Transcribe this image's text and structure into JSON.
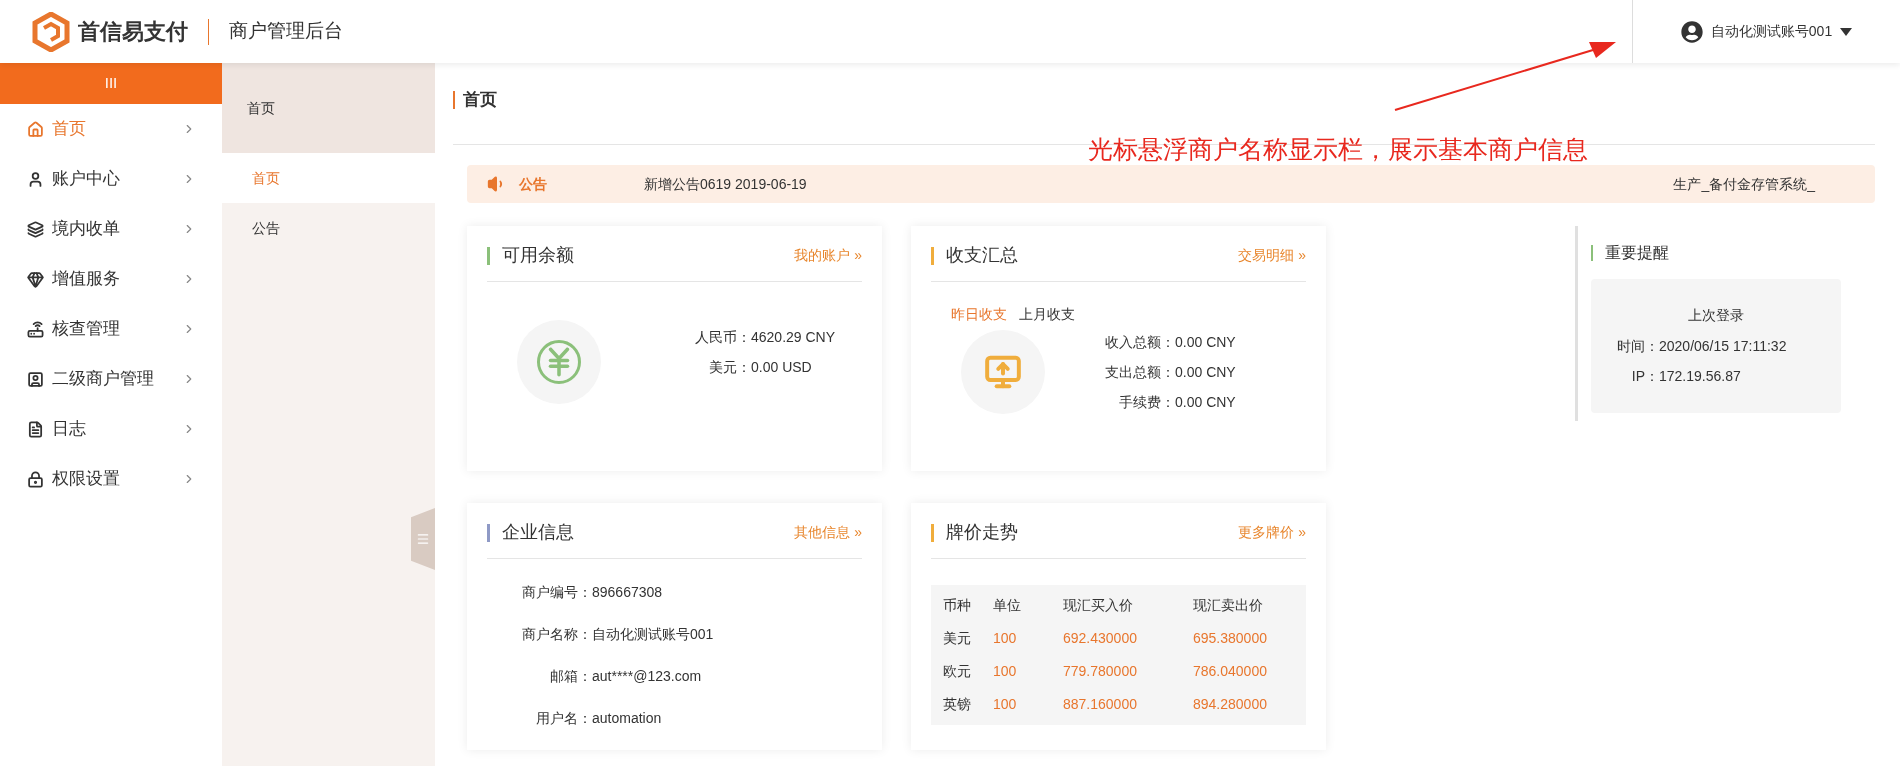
{
  "header": {
    "brand": "首信易支付",
    "subtitle": "商户管理后台",
    "user": "自动化测试账号001"
  },
  "sidebar": {
    "toggle": "III",
    "items": [
      {
        "label": "首页",
        "selected": true
      },
      {
        "label": "账户中心",
        "selected": false
      },
      {
        "label": "境内收单",
        "selected": false
      },
      {
        "label": "增值服务",
        "selected": false
      },
      {
        "label": "核查管理",
        "selected": false
      },
      {
        "label": "二级商户管理",
        "selected": false
      },
      {
        "label": "日志",
        "selected": false
      },
      {
        "label": "权限设置",
        "selected": false
      }
    ]
  },
  "subnav": {
    "title": "首页",
    "items": [
      {
        "label": "首页",
        "selected": true
      },
      {
        "label": "公告",
        "selected": false
      }
    ]
  },
  "page_title": "首页",
  "notice": {
    "label": "公告",
    "text": "新增公告0619 2019-06-19",
    "right": "生产_备付金存管系统_"
  },
  "balance": {
    "title": "可用余额",
    "link": "我的账户 »",
    "rows": [
      {
        "label": "人民币：",
        "value": "4620.29 CNY"
      },
      {
        "label": "美元：",
        "value": "0.00 USD"
      }
    ]
  },
  "summary": {
    "title": "收支汇总",
    "link": "交易明细 »",
    "tabs": [
      {
        "label": "昨日收支",
        "selected": true
      },
      {
        "label": "上月收支",
        "selected": false
      }
    ],
    "rows": [
      {
        "label": "收入总额：",
        "value": "0.00 CNY"
      },
      {
        "label": "支出总额：",
        "value": "0.00 CNY"
      },
      {
        "label": "手续费：",
        "value": "0.00 CNY"
      }
    ]
  },
  "company": {
    "title": "企业信息",
    "link": "其他信息 »",
    "rows": [
      {
        "label": "商户编号：",
        "value": "896667308"
      },
      {
        "label": "商户名称：",
        "value": "自动化测试账号001"
      },
      {
        "label": "邮箱：",
        "value": "aut****@123.com"
      },
      {
        "label": "用户名：",
        "value": "automation"
      }
    ]
  },
  "rates": {
    "title": "牌价走势",
    "link": "更多牌价 »",
    "columns": [
      "币种",
      "单位",
      "现汇买入价",
      "现汇卖出价"
    ],
    "rows": [
      [
        "美元",
        "100",
        "692.430000",
        "695.380000"
      ],
      [
        "欧元",
        "100",
        "779.780000",
        "786.040000"
      ],
      [
        "英镑",
        "100",
        "887.160000",
        "894.280000"
      ]
    ]
  },
  "reminder": {
    "title": "重要提醒",
    "subtitle": "上次登录",
    "rows": [
      {
        "label": "时间：",
        "value": "2020/06/15 17:11:32"
      },
      {
        "label": "IP：",
        "value": "172.19.56.87"
      }
    ]
  },
  "annotation": "光标悬浮商户名称显示栏，展示基本商户信息"
}
